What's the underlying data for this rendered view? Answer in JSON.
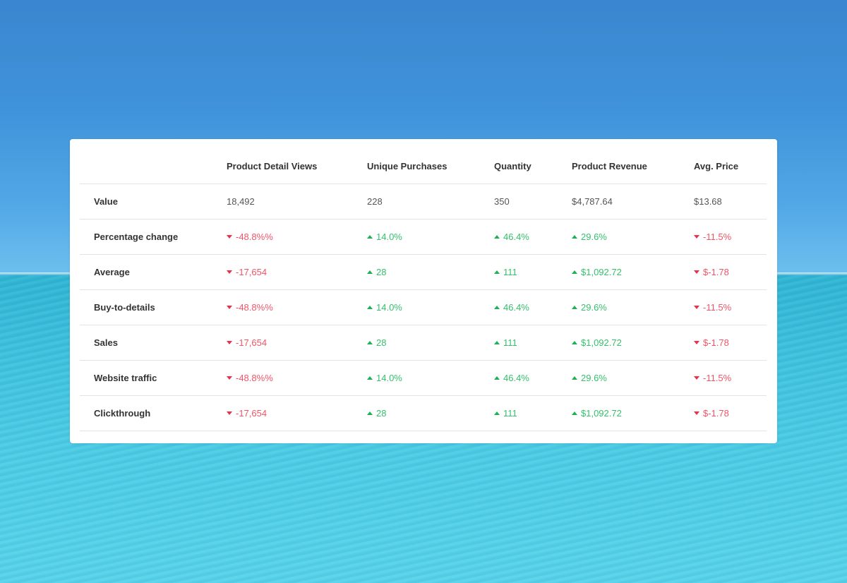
{
  "colors": {
    "positive": "#35c06b",
    "negative": "#f05467",
    "card_background": "#ffffff"
  },
  "table": {
    "headers": [
      "",
      "Product Detail Views",
      "Unique Purchases",
      "Quantity",
      "Product Revenue",
      "Avg. Price"
    ],
    "rows": [
      {
        "label": "Value",
        "cells": [
          {
            "text": "18,492",
            "trend": "none"
          },
          {
            "text": "228",
            "trend": "none"
          },
          {
            "text": "350",
            "trend": "none"
          },
          {
            "text": "$4,787.64",
            "trend": "none"
          },
          {
            "text": "$13.68",
            "trend": "none"
          }
        ]
      },
      {
        "label": "Percentage change",
        "cells": [
          {
            "text": "-48.8%%",
            "trend": "down"
          },
          {
            "text": "14.0%",
            "trend": "up"
          },
          {
            "text": "46.4%",
            "trend": "up"
          },
          {
            "text": "29.6%",
            "trend": "up"
          },
          {
            "text": "-11.5%",
            "trend": "down"
          }
        ]
      },
      {
        "label": "Average",
        "cells": [
          {
            "text": "-17,654",
            "trend": "down"
          },
          {
            "text": "28",
            "trend": "up"
          },
          {
            "text": "111",
            "trend": "up"
          },
          {
            "text": "$1,092.72",
            "trend": "up"
          },
          {
            "text": "$-1.78",
            "trend": "down"
          }
        ]
      },
      {
        "label": "Buy-to-details",
        "cells": [
          {
            "text": "-48.8%%",
            "trend": "down"
          },
          {
            "text": "14.0%",
            "trend": "up"
          },
          {
            "text": "46.4%",
            "trend": "up"
          },
          {
            "text": "29.6%",
            "trend": "up"
          },
          {
            "text": "-11.5%",
            "trend": "down"
          }
        ]
      },
      {
        "label": "Sales",
        "cells": [
          {
            "text": "-17,654",
            "trend": "down"
          },
          {
            "text": "28",
            "trend": "up"
          },
          {
            "text": "111",
            "trend": "up"
          },
          {
            "text": "$1,092.72",
            "trend": "up"
          },
          {
            "text": "$-1.78",
            "trend": "down"
          }
        ]
      },
      {
        "label": "Website traffic",
        "cells": [
          {
            "text": "-48.8%%",
            "trend": "down"
          },
          {
            "text": "14.0%",
            "trend": "up"
          },
          {
            "text": "46.4%",
            "trend": "up"
          },
          {
            "text": "29.6%",
            "trend": "up"
          },
          {
            "text": "-11.5%",
            "trend": "down"
          }
        ]
      },
      {
        "label": "Clickthrough",
        "cells": [
          {
            "text": "-17,654",
            "trend": "down"
          },
          {
            "text": "28",
            "trend": "up"
          },
          {
            "text": "111",
            "trend": "up"
          },
          {
            "text": "$1,092.72",
            "trend": "up"
          },
          {
            "text": "$-1.78",
            "trend": "down"
          }
        ]
      }
    ]
  },
  "icons": {
    "up": "triangle-up-icon",
    "down": "triangle-down-icon"
  }
}
